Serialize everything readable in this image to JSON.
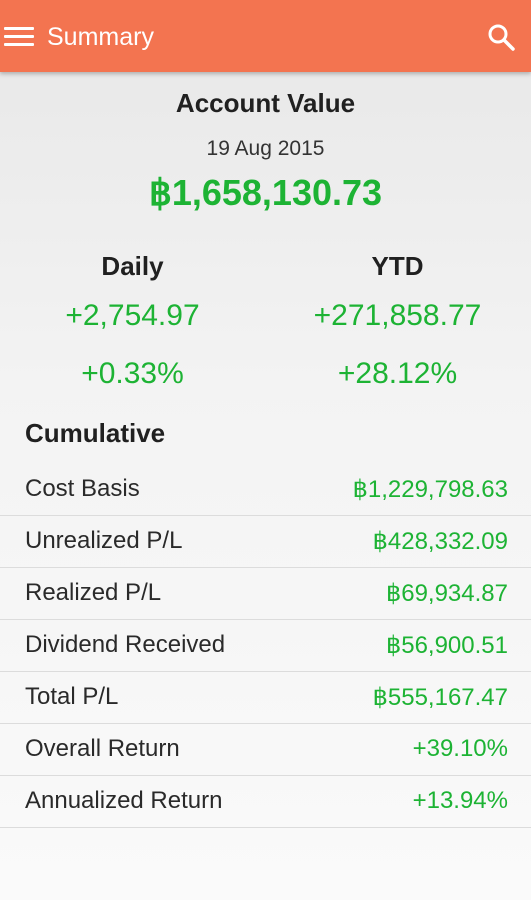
{
  "appbar": {
    "title": "Summary",
    "background": "#f37450",
    "left_icon": "menu-icon",
    "right_icon": "search-icon"
  },
  "account": {
    "title": "Account Value",
    "date": "19 Aug 2015",
    "value": "฿1,658,130.73"
  },
  "daily": {
    "label": "Daily",
    "change": "+2,754.97",
    "percent": "+0.33%"
  },
  "ytd": {
    "label": "YTD",
    "change": "+271,858.77",
    "percent": "+28.12%"
  },
  "cumulative": {
    "title": "Cumulative",
    "rows": [
      {
        "label": "Cost Basis",
        "value": "฿1,229,798.63"
      },
      {
        "label": "Unrealized P/L",
        "value": "฿428,332.09"
      },
      {
        "label": "Realized P/L",
        "value": "฿69,934.87"
      },
      {
        "label": "Dividend Received",
        "value": "฿56,900.51"
      },
      {
        "label": "Total P/L",
        "value": "฿555,167.47"
      },
      {
        "label": "Overall Return",
        "value": "+39.10%"
      },
      {
        "label": "Annualized Return",
        "value": "+13.94%"
      }
    ]
  },
  "colors": {
    "positive": "#1db334",
    "accent": "#f37450"
  }
}
